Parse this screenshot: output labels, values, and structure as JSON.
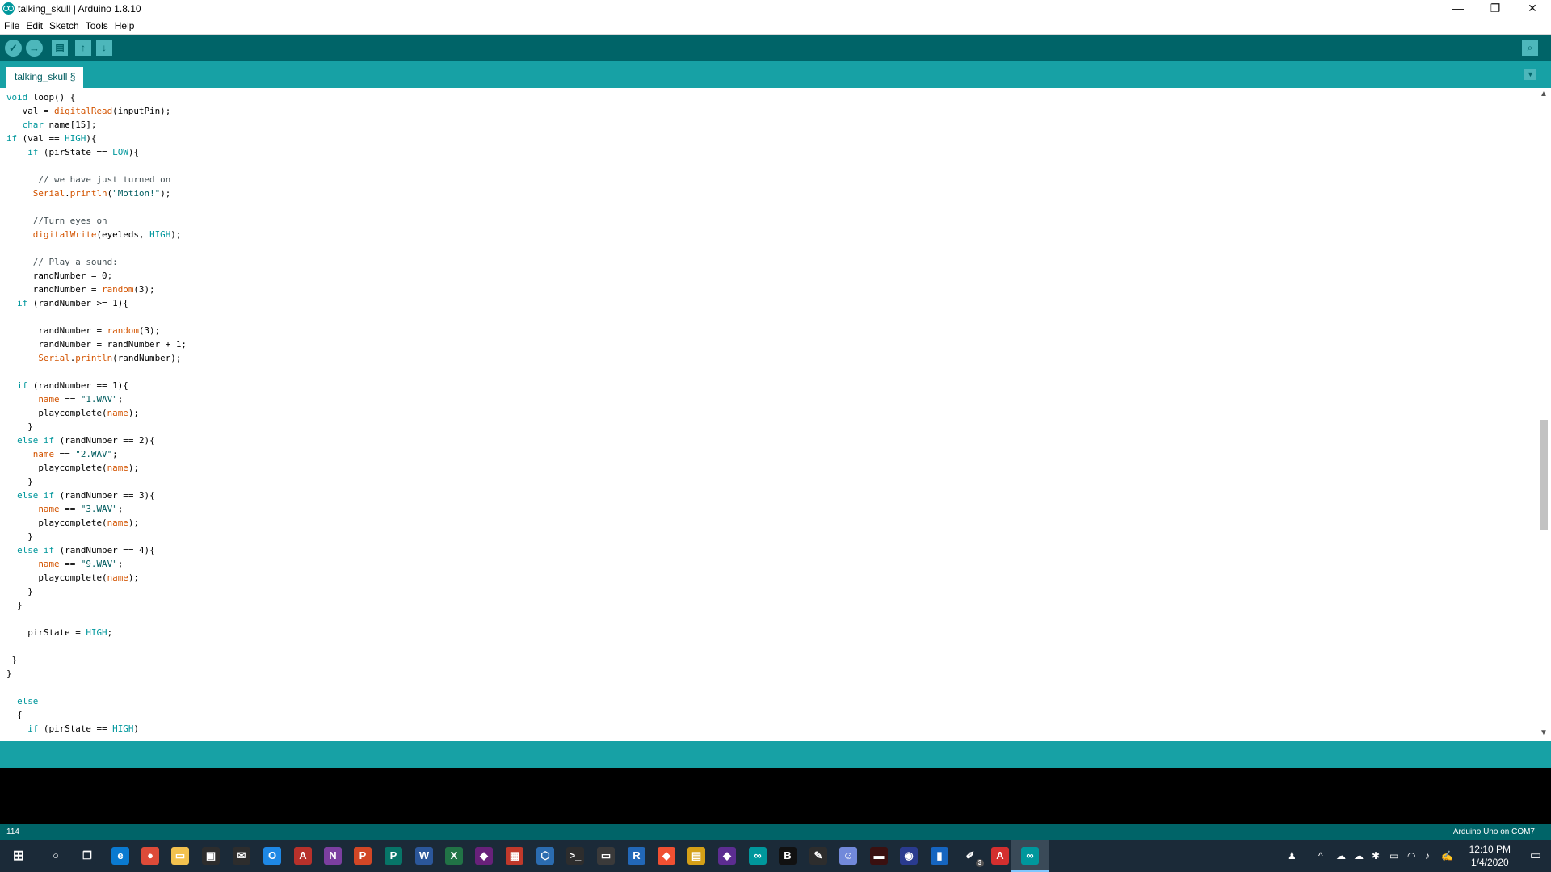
{
  "window": {
    "title": "talking_skull | Arduino 1.8.10",
    "minimize": "—",
    "restore": "❐",
    "close": "✕"
  },
  "menu": [
    "File",
    "Edit",
    "Sketch",
    "Tools",
    "Help"
  ],
  "toolbar": {
    "verify": "✓",
    "upload": "→",
    "new": "▤",
    "open": "↑",
    "save": "↓",
    "serial_monitor": "⌕"
  },
  "tab": {
    "label": "talking_skull §",
    "menu_arrow": "▼"
  },
  "code": [
    [
      [
        "void",
        "kt"
      ],
      [
        " loop() {",
        ""
      ]
    ],
    [
      [
        "   val = ",
        ""
      ],
      [
        "digitalRead",
        "fn"
      ],
      [
        "(inputPin);",
        ""
      ]
    ],
    [
      [
        "   ",
        ""
      ],
      [
        "char",
        "kt"
      ],
      [
        " name[15];",
        ""
      ]
    ],
    [
      [
        "if",
        "kt"
      ],
      [
        " (val == ",
        ""
      ],
      [
        "HIGH",
        "cn"
      ],
      [
        "){",
        ""
      ]
    ],
    [
      [
        "    ",
        ""
      ],
      [
        "if",
        "kt"
      ],
      [
        " (pirState == ",
        ""
      ],
      [
        "LOW",
        "cn"
      ],
      [
        "){",
        ""
      ]
    ],
    [],
    [
      [
        "      // we have just turned on",
        "cm"
      ]
    ],
    [
      [
        "     ",
        ""
      ],
      [
        "Serial",
        "fn"
      ],
      [
        ".",
        ""
      ],
      [
        "println",
        "fn"
      ],
      [
        "(",
        ""
      ],
      [
        "\"Motion!\"",
        "st"
      ],
      [
        ");",
        ""
      ]
    ],
    [],
    [
      [
        "     //Turn eyes on",
        "cm"
      ]
    ],
    [
      [
        "     ",
        ""
      ],
      [
        "digitalWrite",
        "fn"
      ],
      [
        "(eyeleds, ",
        ""
      ],
      [
        "HIGH",
        "cn"
      ],
      [
        ");",
        ""
      ]
    ],
    [],
    [
      [
        "     // Play a sound:",
        "cm"
      ]
    ],
    [
      [
        "     randNumber = 0;",
        ""
      ]
    ],
    [
      [
        "     randNumber = ",
        ""
      ],
      [
        "random",
        "fn"
      ],
      [
        "(3);",
        ""
      ]
    ],
    [
      [
        "  ",
        ""
      ],
      [
        "if",
        "kt"
      ],
      [
        " (randNumber >= 1){",
        ""
      ]
    ],
    [],
    [
      [
        "      randNumber = ",
        ""
      ],
      [
        "random",
        "fn"
      ],
      [
        "(3);",
        ""
      ]
    ],
    [
      [
        "      randNumber = randNumber + 1;",
        ""
      ]
    ],
    [
      [
        "      ",
        ""
      ],
      [
        "Serial",
        "fn"
      ],
      [
        ".",
        ""
      ],
      [
        "println",
        "fn"
      ],
      [
        "(randNumber);",
        ""
      ]
    ],
    [],
    [
      [
        "  ",
        ""
      ],
      [
        "if",
        "kt"
      ],
      [
        " (randNumber == 1){",
        ""
      ]
    ],
    [
      [
        "      ",
        ""
      ],
      [
        "name",
        "fn"
      ],
      [
        " == ",
        ""
      ],
      [
        "\"1.WAV\"",
        "st"
      ],
      [
        ";",
        ""
      ]
    ],
    [
      [
        "      playcomplete(",
        ""
      ],
      [
        "name",
        "fn"
      ],
      [
        ");",
        ""
      ]
    ],
    [
      [
        "    }",
        ""
      ]
    ],
    [
      [
        "  ",
        ""
      ],
      [
        "else",
        "kt"
      ],
      [
        " ",
        ""
      ],
      [
        "if",
        "kt"
      ],
      [
        " (randNumber == 2){",
        ""
      ]
    ],
    [
      [
        "     ",
        ""
      ],
      [
        "name",
        "fn"
      ],
      [
        " == ",
        ""
      ],
      [
        "\"2.WAV\"",
        "st"
      ],
      [
        ";",
        ""
      ]
    ],
    [
      [
        "      playcomplete(",
        ""
      ],
      [
        "name",
        "fn"
      ],
      [
        ");",
        ""
      ]
    ],
    [
      [
        "    }",
        ""
      ]
    ],
    [
      [
        "  ",
        ""
      ],
      [
        "else",
        "kt"
      ],
      [
        " ",
        ""
      ],
      [
        "if",
        "kt"
      ],
      [
        " (randNumber == 3){",
        ""
      ]
    ],
    [
      [
        "      ",
        ""
      ],
      [
        "name",
        "fn"
      ],
      [
        " == ",
        ""
      ],
      [
        "\"3.WAV\"",
        "st"
      ],
      [
        ";",
        ""
      ]
    ],
    [
      [
        "      playcomplete(",
        ""
      ],
      [
        "name",
        "fn"
      ],
      [
        ");",
        ""
      ]
    ],
    [
      [
        "    }",
        ""
      ]
    ],
    [
      [
        "  ",
        ""
      ],
      [
        "else",
        "kt"
      ],
      [
        " ",
        ""
      ],
      [
        "if",
        "kt"
      ],
      [
        " (randNumber == 4){",
        ""
      ]
    ],
    [
      [
        "      ",
        ""
      ],
      [
        "name",
        "fn"
      ],
      [
        " == ",
        ""
      ],
      [
        "\"9.WAV\"",
        "st"
      ],
      [
        ";",
        ""
      ]
    ],
    [
      [
        "      playcomplete(",
        ""
      ],
      [
        "name",
        "fn"
      ],
      [
        ");",
        ""
      ]
    ],
    [
      [
        "    }",
        ""
      ]
    ],
    [
      [
        "  }",
        ""
      ]
    ],
    [],
    [
      [
        "    pirState = ",
        ""
      ],
      [
        "HIGH",
        "cn"
      ],
      [
        ";",
        ""
      ]
    ],
    [],
    [
      [
        " }",
        ""
      ]
    ],
    [
      [
        "}",
        ""
      ]
    ],
    [],
    [
      [
        "  ",
        ""
      ],
      [
        "else",
        "kt"
      ]
    ],
    [
      [
        "  {",
        ""
      ]
    ],
    [
      [
        "    ",
        ""
      ],
      [
        "if",
        "kt"
      ],
      [
        " (pirState == ",
        ""
      ],
      [
        "HIGH",
        "cn"
      ],
      [
        ")",
        ""
      ]
    ]
  ],
  "status": {
    "line_number": "114",
    "board": "Arduino Uno on COM7"
  },
  "taskbar": {
    "start": "⊞",
    "icons": [
      {
        "name": "search-icon",
        "glyph": "○",
        "color": "#1b2a38"
      },
      {
        "name": "task-view-icon",
        "glyph": "❐",
        "color": "#1b2a38"
      },
      {
        "name": "edge-icon",
        "glyph": "e",
        "color": "#0a7ad1"
      },
      {
        "name": "chrome-icon",
        "glyph": "●",
        "color": "#dd4b39"
      },
      {
        "name": "file-explorer-icon",
        "glyph": "▭",
        "color": "#f2c14e"
      },
      {
        "name": "store-icon",
        "glyph": "▣",
        "color": "#2d2d2d"
      },
      {
        "name": "mail-icon",
        "glyph": "✉",
        "color": "#2d2d2d"
      },
      {
        "name": "outlook-icon",
        "glyph": "O",
        "color": "#1e88e5"
      },
      {
        "name": "access-icon",
        "glyph": "A",
        "color": "#b7312b"
      },
      {
        "name": "onenote-icon",
        "glyph": "N",
        "color": "#7b3fa0"
      },
      {
        "name": "powerpoint-icon",
        "glyph": "P",
        "color": "#d24726"
      },
      {
        "name": "publisher-icon",
        "glyph": "P",
        "color": "#077568"
      },
      {
        "name": "word-icon",
        "glyph": "W",
        "color": "#2b579a"
      },
      {
        "name": "excel-icon",
        "glyph": "X",
        "color": "#217346"
      },
      {
        "name": "visual-studio-icon",
        "glyph": "◆",
        "color": "#68217a"
      },
      {
        "name": "tiles-app-icon",
        "glyph": "▦",
        "color": "#c0392b"
      },
      {
        "name": "cube-app-icon",
        "glyph": "⬡",
        "color": "#2b6cb0"
      },
      {
        "name": "terminal-icon",
        "glyph": ">_",
        "color": "#2d2d2d"
      },
      {
        "name": "window-app-icon",
        "glyph": "▭",
        "color": "#3a3a3a"
      },
      {
        "name": "r-icon",
        "glyph": "R",
        "color": "#2268b8"
      },
      {
        "name": "git-icon",
        "glyph": "◆",
        "color": "#f05032"
      },
      {
        "name": "folder-lock-icon",
        "glyph": "▤",
        "color": "#d4a017"
      },
      {
        "name": "vs-code-icon",
        "glyph": "◆",
        "color": "#5c2d91"
      },
      {
        "name": "arduino-icon",
        "glyph": "∞",
        "color": "#00979c"
      },
      {
        "name": "b-app-icon",
        "glyph": "B",
        "color": "#111111"
      },
      {
        "name": "inkscape-icon",
        "glyph": "✎",
        "color": "#2d2d2d"
      },
      {
        "name": "discord-icon",
        "glyph": "☺",
        "color": "#7289da"
      },
      {
        "name": "dark-app-icon",
        "glyph": "▬",
        "color": "#3a1010"
      },
      {
        "name": "network-app-icon",
        "glyph": "◉",
        "color": "#2a3b8f"
      },
      {
        "name": "notepad-icon",
        "glyph": "▮",
        "color": "#1565c0"
      },
      {
        "name": "pen-app-icon",
        "glyph": "✐",
        "color": "#1b2a38"
      },
      {
        "name": "acrobat-icon",
        "glyph": "A",
        "color": "#d32f2f"
      },
      {
        "name": "arduino-active-icon",
        "glyph": "∞",
        "color": "#00979c"
      }
    ],
    "pen_badge": "3",
    "tray": [
      "♟",
      "^",
      "☁",
      "☁",
      "✱",
      "▭",
      "◠",
      "♪",
      "✍"
    ],
    "time": "12:10 PM",
    "date": "1/4/2020",
    "notification": "▭"
  }
}
